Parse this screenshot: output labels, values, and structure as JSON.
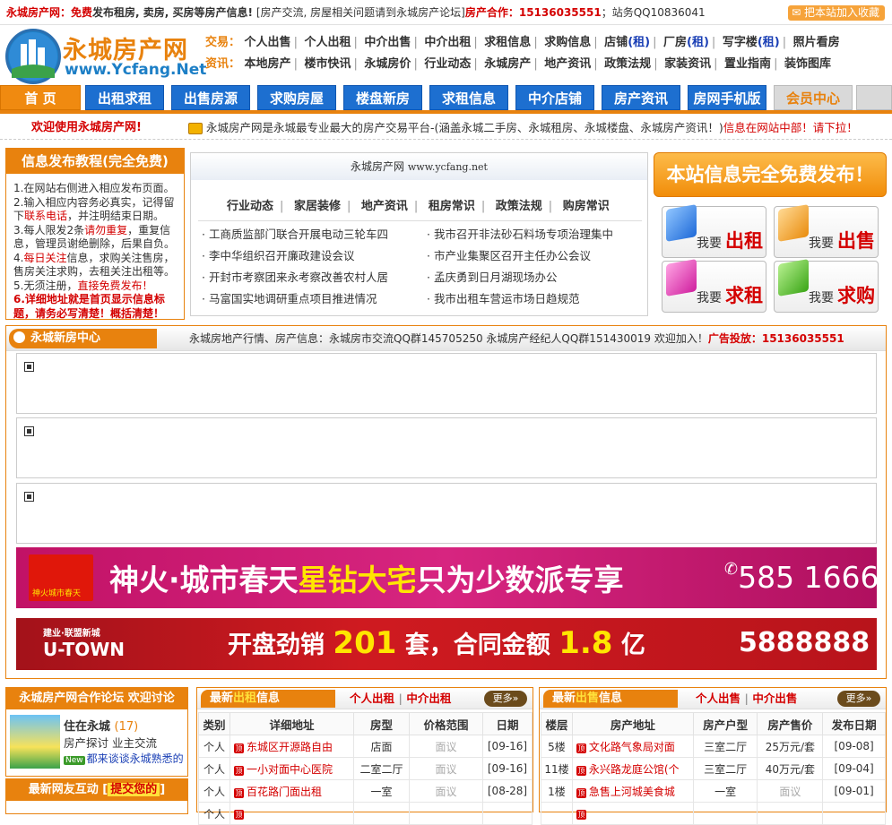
{
  "topbar": {
    "site": "永城房产网",
    "colon": "：",
    "free": "免费",
    "slogan_rest": "发布租房, 卖房, 买房等房产信息!",
    "forum_pre": "[房产交流, 房屋相关问题请到",
    "forum_link": "永城房产论坛",
    "forum_post": "]",
    "coop": "房产合作：15136035551",
    "qq": "；站务QQ10836041",
    "fav": "把本站加入收藏"
  },
  "logo": {
    "cn": "永城房产网",
    "en": "www.Ycfang.Net"
  },
  "nav": {
    "trade_label": "交易：",
    "trade": [
      "个人出售",
      "个人出租",
      "中介出售",
      "中介出租",
      "求租信息",
      "求购信息"
    ],
    "trade_blue": [
      {
        "pre": "店铺",
        "paren": "(租)"
      },
      {
        "pre": "厂房",
        "paren": "(租)"
      },
      {
        "pre": "写字楼",
        "paren": "(租)"
      }
    ],
    "trade_last": "照片看房",
    "info_label": "资讯：",
    "info": [
      "本地房产",
      "楼市快讯",
      "永城房价",
      "行业动态",
      "永城房产",
      "地产资讯",
      "政策法规",
      "家装资讯",
      "置业指南",
      "装饰图库"
    ]
  },
  "menu": [
    "首 页",
    "出租求租",
    "出售房源",
    "求购房屋",
    "楼盘新房",
    "求租信息",
    "中介店铺",
    "房产资讯",
    "房网手机版",
    "会员中心"
  ],
  "welcome": {
    "left": "欢迎使用永城房产网!",
    "ticker_a": "永城房产网是永城最专业最大的房产交易平台-(涵盖永城二手房、永城租房、永城楼盘、永城房产资讯！)",
    "ticker_b": "信息在网站中部！请下拉！"
  },
  "tutorial": {
    "title": "信息发布教程(完全免费)",
    "l1": "1.在网站右侧进入相应发布页面。",
    "l2a": "2.输入相应内容务必真实，记得留下",
    "l2b": "联系电话",
    "l2c": "，并注明结束日期。",
    "l3a": "3.每人限发2条",
    "l3b": "请勿重复",
    "l3c": "，重复信息，管理员谢绝删除，后果自负。",
    "l4a": "4.",
    "l4b": "每日关注",
    "l4c": "信息，求购关注售房，售房关注求购，去租关注出租等。",
    "l5a": "5.无须注册，",
    "l5b": "直接免费发布！",
    "l6": "6.详细地址就是首页显示信息标题，请务必写清楚！概括清楚！"
  },
  "news": {
    "header_name": "永城房产网",
    "header_url": "www.ycfang.net",
    "tabs": [
      "行业动态",
      "家居装修",
      "地产资讯",
      "租房常识",
      "政策法规",
      "购房常识"
    ],
    "left": [
      "工商质监部门联合开展电动三轮车四",
      "李中华组织召开廉政建设会议",
      "开封市考察团来永考察改善农村人居",
      "马富国实地调研重点项目推进情况"
    ],
    "right": [
      "我市召开非法砂石料场专项治理集中",
      "市产业集聚区召开主任办公会议",
      "孟庆勇到日月湖现场办公",
      "我市出租车营运市场日趋规范"
    ]
  },
  "free_post": {
    "banner": "本站信息完全免费发布！",
    "buttons": [
      {
        "small": "我要",
        "big": "出租",
        "color": "#2b7fe0"
      },
      {
        "small": "我要",
        "big": "出售",
        "color": "#f2a21b"
      },
      {
        "small": "我要",
        "big": "求租",
        "color": "#e03ab0"
      },
      {
        "small": "我要",
        "big": "求购",
        "color": "#4cc02a"
      }
    ]
  },
  "new_house": {
    "title": "永城新房中心",
    "info": "永城房地产行情、房产信息：永城房市交流QQ群145705250 永城房产经纪人QQ群151430019 欢迎加入！",
    "ad_label": "广告投放：15136035551",
    "ad1": {
      "brand": "神火",
      "mid": "·城市春天",
      "star": "星钻大宅",
      "rest": "只为少数派专享",
      "tel": "585 1666",
      "logo": "神火城市春天"
    },
    "ad2": {
      "logo": "U-TOWN",
      "logo_sub": "建业·联盟新城",
      "t1": "开盘劲销",
      "n1": "201",
      "t2": "套，合同金额",
      "n2": "1.8",
      "t3": "亿",
      "tel": "5888888"
    }
  },
  "forum": {
    "title": "永城房产网合作论坛 欢迎讨论",
    "name": "住在永城",
    "count": "(17)",
    "desc": "房产探讨 业主交流",
    "tag": "New",
    "last": "都来谈谈永城熟悉的",
    "interact_pre": "最新网友互动",
    "interact_link": "提交您的"
  },
  "rent": {
    "title_pre": "最新",
    "title_hl": "出租",
    "title_post": "信息",
    "link1": "个人出租",
    "sep": "|",
    "link2": "中介出租",
    "more": "更多",
    "headers": [
      "类别",
      "详细地址",
      "房型",
      "价格范围",
      "日期"
    ],
    "rows": [
      [
        "个人",
        "东城区开源路自由",
        "店面",
        "面议",
        "[09-16]"
      ],
      [
        "个人",
        "一小对面中心医院",
        "二室二厅",
        "面议",
        "[09-16]"
      ],
      [
        "个人",
        "百花路门面出租",
        "一室",
        "面议",
        "[08-28]"
      ],
      [
        "个人",
        "",
        "",
        "",
        ""
      ]
    ]
  },
  "sale": {
    "title_pre": "最新",
    "title_hl": "出售",
    "title_post": "信息",
    "link1": "个人出售",
    "sep": "|",
    "link2": "中介出售",
    "more": "更多",
    "headers": [
      "楼层",
      "房产地址",
      "房产户型",
      "房产售价",
      "发布日期"
    ],
    "rows": [
      [
        "5楼",
        "文化路气象局对面",
        "三室二厅",
        "25万元/套",
        "[09-08]"
      ],
      [
        "11楼",
        "永兴路龙庭公馆(个",
        "三室二厅",
        "40万元/套",
        "[09-04]"
      ],
      [
        "1楼",
        "急售上河城美食城",
        "一室",
        "面议",
        "[09-01]"
      ],
      [
        "",
        "",
        "",
        "",
        ""
      ]
    ]
  },
  "colors": {
    "orange": "#e8820e",
    "blue": "#1d6fd0",
    "red": "#d40000"
  }
}
